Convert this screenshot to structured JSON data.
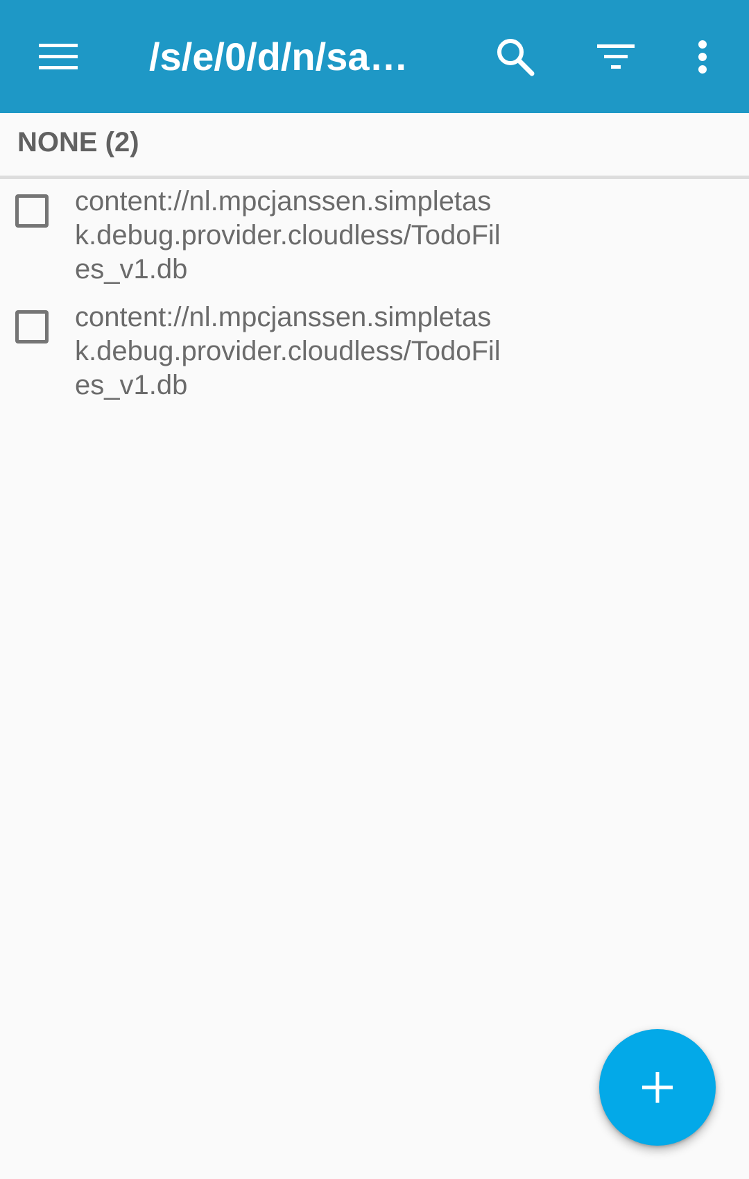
{
  "toolbar": {
    "title": "/s/e/0/d/n/sa…",
    "menu_icon": "hamburger-menu-icon",
    "search_icon": "search-icon",
    "filter_icon": "filter-icon",
    "more_icon": "more-vert-icon",
    "background_color": "#1e98c6"
  },
  "section": {
    "label": "NONE (2)"
  },
  "tasks": [
    {
      "text": "content://nl.mpcjanssen.simpletask.debug.provider.cloudless/TodoFiles_v1.db",
      "checked": false
    },
    {
      "text": "content://nl.mpcjanssen.simpletask.debug.provider.cloudless/TodoFiles_v1.db",
      "checked": false
    }
  ],
  "fab": {
    "icon": "plus-icon",
    "color": "#03a9e8"
  }
}
